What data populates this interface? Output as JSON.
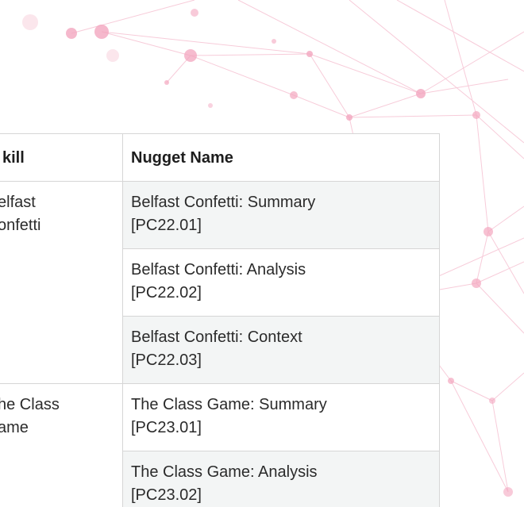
{
  "table": {
    "headers": [
      "kill",
      "Nugget Name"
    ],
    "rows": [
      {
        "skill": "elfast\nonfetti",
        "nugget": "Belfast Confetti: Summary\n[PC22.01]",
        "shade": true,
        "rowspan": 3
      },
      {
        "nugget": "Belfast Confetti: Analysis\n[PC22.02]",
        "shade": false
      },
      {
        "nugget": "Belfast Confetti: Context\n[PC22.03]",
        "shade": true
      },
      {
        "skill": "he Class\name",
        "nugget": "The Class Game: Summary\n[PC23.01]",
        "shade": false,
        "rowspan": 2
      },
      {
        "nugget": "The Class Game: Analysis\n[PC23.02]",
        "shade": true
      }
    ]
  },
  "colors": {
    "network_pink": "#f4a8c0",
    "cell_shade": "#f3f5f5",
    "border": "#d6d6d6"
  }
}
